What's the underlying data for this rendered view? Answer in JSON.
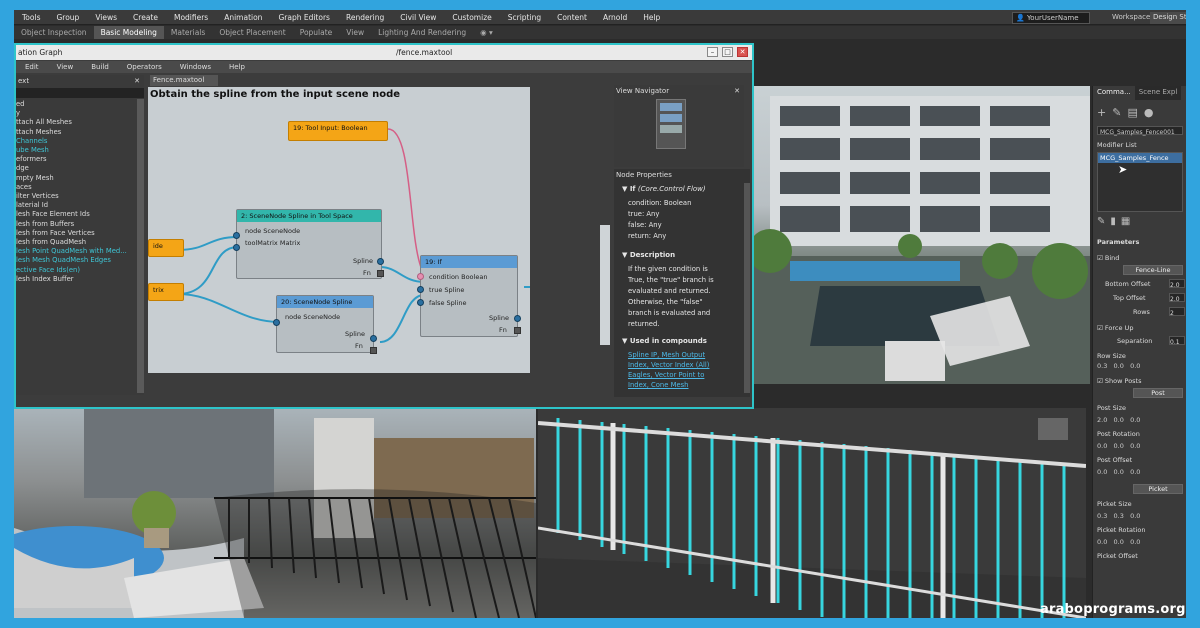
{
  "menubar": {
    "items": [
      "Tools",
      "Group",
      "Views",
      "Create",
      "Modifiers",
      "Animation",
      "Graph Editors",
      "Rendering",
      "Civil View",
      "Customize",
      "Scripting",
      "Content",
      "Arnold",
      "Help"
    ],
    "user": "YourUserName",
    "workspaces_label": "Workspaces:",
    "workspaces_value": "Design St"
  },
  "ribbon": {
    "tabs": [
      "Object Inspection",
      "Basic Modeling",
      "Materials",
      "Object Placement",
      "Populate",
      "View",
      "Lighting And Rendering"
    ],
    "active_index": 1
  },
  "mcg": {
    "title": "ation Graph",
    "file": "/fence.maxtool",
    "menu": [
      "Edit",
      "View",
      "Build",
      "Operators",
      "Windows",
      "Help"
    ],
    "left_header": "ext",
    "left_items": [
      {
        "t": "ed",
        "c": false
      },
      {
        "t": "y",
        "c": false
      },
      {
        "t": "",
        "c": false
      },
      {
        "t": "ttach All Meshes",
        "c": false
      },
      {
        "t": "ttach Meshes",
        "c": false
      },
      {
        "t": "Channels",
        "c": true
      },
      {
        "t": "ube Mesh",
        "c": true
      },
      {
        "t": "eformers",
        "c": false
      },
      {
        "t": "dge",
        "c": false
      },
      {
        "t": "mpty Mesh",
        "c": false
      },
      {
        "t": "aces",
        "c": false
      },
      {
        "t": "ilter Vertices",
        "c": false
      },
      {
        "t": "laterial Id",
        "c": false
      },
      {
        "t": "lesh Face Element Ids",
        "c": false
      },
      {
        "t": "lesh from Buffers",
        "c": false
      },
      {
        "t": "lesh from Face Vertices",
        "c": false
      },
      {
        "t": "lesh from QuadMesh",
        "c": false
      },
      {
        "t": "lesh Point QuadMesh with Med...",
        "c": true
      },
      {
        "t": "lesh Mesh QuadMesh Edges",
        "c": true
      },
      {
        "t": "ective Face Ids(en)",
        "c": true
      },
      {
        "t": "lesh Index Buffer",
        "c": false
      }
    ],
    "tab": "Fence.maxtool",
    "canvas_title": "Obtain the spline from the input scene node",
    "nodes": {
      "tool_input": "19: Tool Input: Boolean",
      "scene_tool_space": "2: SceneNode Spline in Tool Space",
      "scene_tool_space_p1": "node SceneNode",
      "scene_tool_space_p2": "toolMatrix Matrix",
      "scene_spline": "20: SceneNode Spline",
      "scene_spline_p1": "node SceneNode",
      "if_node": "19: If",
      "if_p1": "condition Boolean",
      "if_p2": "true Spline",
      "if_p3": "false Spline",
      "out_spline": "Spline",
      "out_fn": "Fn",
      "left1": "ide",
      "left2": "trix"
    },
    "navigator": "View Navigator",
    "properties": {
      "header": "Node Properties",
      "title": "If",
      "title_sub": "(Core.Control Flow)",
      "lines": [
        "condition: Boolean",
        "true: Any",
        "false: Any",
        "return: Any"
      ],
      "desc_title": "Description",
      "desc": [
        "If the given condition is",
        "True, the \"true\" branch is",
        "evaluated and returned.",
        "Otherwise, the \"false\"",
        "branch is evaluated and",
        "returned."
      ],
      "used_title": "Used in compounds",
      "used": [
        "Spline IP, Mesh Output",
        "Index, Vector Index (All)",
        "Eagles, Vector Point to",
        "Index, Cone Mesh"
      ]
    }
  },
  "cmd": {
    "tab1": "Comma...",
    "tab2": "Scene Expl",
    "object": "MCG_Samples_Fence001",
    "modlist_label": "Modifier List",
    "modlist_item": "MCG_Samples_Fence",
    "params": "Parameters",
    "bind": "Bind",
    "fence_btn": "Fence-Line",
    "bottom_offset": "Bottom Offset",
    "bottom_val": "2.0",
    "top_offset": "Top Offset",
    "top_val": "2.0",
    "rows": "Rows",
    "rows_val": "2",
    "force_up": "Force Up",
    "separation": "Separation",
    "separation_val": "0.1",
    "row_size": "Row Size",
    "show_posts": "Show Posts",
    "post_btn": "Post",
    "post_size": "Post Size",
    "post_rotation": "Post Rotation",
    "post_offset": "Post Offset",
    "picket_btn": "Picket",
    "picket_size": "Picket Size",
    "picket_rotation": "Picket Rotation",
    "picket_offset": "Picket Offset",
    "v1": "0.3",
    "v2": "0.0",
    "v3": "2.0",
    "v4": "0.0"
  },
  "watermark": "araboprograms.org"
}
